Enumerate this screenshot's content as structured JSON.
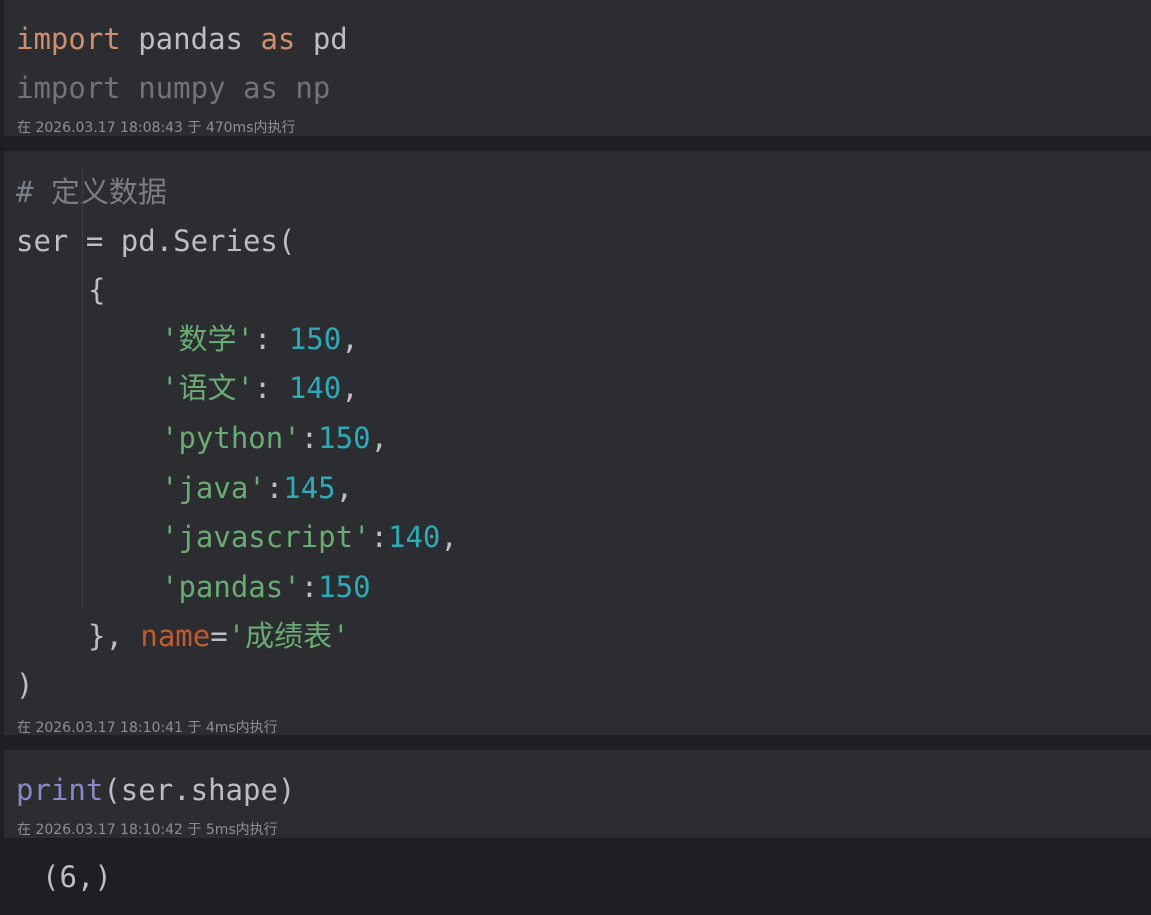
{
  "cells": [
    {
      "lines": [
        {
          "kw": "import",
          "text": " pandas ",
          "kw2": "as",
          "text2": " pd"
        },
        {
          "kw": "import",
          "text": " numpy ",
          "kw2": "as",
          "text2": " np"
        }
      ],
      "meta": "在 2026.03.17 18:08:43 于 470ms内执行"
    },
    {
      "comment": "# 定义数据",
      "line_ser": "ser = pd.Series(",
      "open_brace": "{",
      "entries": [
        {
          "key": "'数学'",
          "sep": ": ",
          "value": "150",
          "tail": ","
        },
        {
          "key": "'语文'",
          "sep": ": ",
          "value": "140",
          "tail": ","
        },
        {
          "key": "'python'",
          "sep": ":",
          "value": "150",
          "tail": ","
        },
        {
          "key": "'java'",
          "sep": ":",
          "value": "145",
          "tail": ","
        },
        {
          "key": "'javascript'",
          "sep": ":",
          "value": "140",
          "tail": ","
        },
        {
          "key": "'pandas'",
          "sep": ":",
          "value": "150",
          "tail": ""
        }
      ],
      "close_brace": "}, ",
      "param": "name",
      "equals": "=",
      "param_value": "'成绩表'",
      "close_paren": ")",
      "meta": "在 2026.03.17 18:10:41 于 4ms内执行"
    },
    {
      "builtin": "print",
      "args": "(ser.shape)",
      "meta": "在 2026.03.17 18:10:42 于 5ms内执行"
    }
  ],
  "output": "(6,)"
}
